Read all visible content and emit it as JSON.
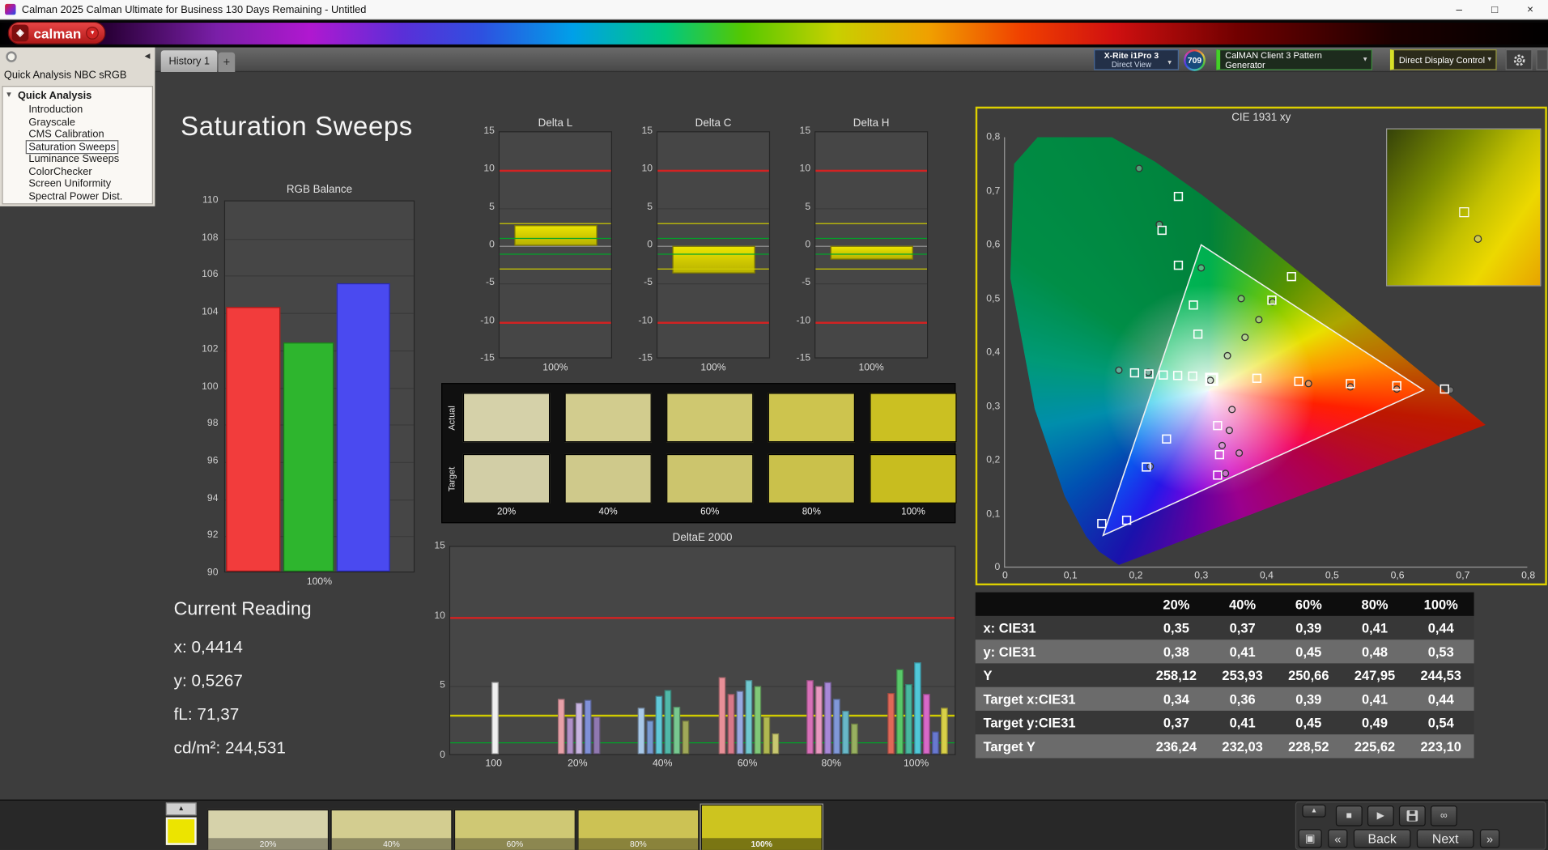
{
  "titlebar": {
    "title": "Calman 2025 Calman Ultimate for Business 130 Days Remaining  - Untitled",
    "minimize": "–",
    "maximize": "□",
    "close": "×"
  },
  "header": {
    "logo_text": "calman",
    "logo_diamond": "◈",
    "logo_caret": "▼"
  },
  "toolbar": {
    "tab": "History 1",
    "add_tab": "+",
    "meter": {
      "line1": "X-Rite i1Pro 3",
      "line2": "Direct View"
    },
    "badge": "709",
    "pattern_generator": "CalMAN Client 3 Pattern Generator",
    "display_control": "Direct Display Control",
    "caret": "▼"
  },
  "sidebar": {
    "icons": {
      "collapse": "◂",
      "toggle": "▾"
    },
    "title": "Quick Analysis NBC sRGB",
    "root": "Quick Analysis",
    "items": [
      "Introduction",
      "Grayscale",
      "CMS Calibration",
      "Saturation Sweeps",
      "Luminance Sweeps",
      "ColorChecker",
      "Screen Uniformity",
      "Spectral Power Dist."
    ],
    "selected": "Saturation Sweeps"
  },
  "main": {
    "title": "Saturation Sweeps",
    "saturation_swatches": {
      "row_labels": [
        "Actual",
        "Target"
      ],
      "percent_labels": [
        "20%",
        "40%",
        "60%",
        "80%",
        "100%"
      ],
      "actual": [
        "#d5d1a9",
        "#d2cc8e",
        "#cfc870",
        "#cdc44e",
        "#cbc022"
      ],
      "target": [
        "#d2cea6",
        "#cfc98b",
        "#ccc56d",
        "#cac14b",
        "#c8bd1f"
      ]
    },
    "current_reading": {
      "heading": "Current Reading",
      "lines": [
        "x: 0,4414",
        "y: 0,5267",
        "fL: 71,37",
        "cd/m²: 244,531"
      ]
    }
  },
  "chart_data": {
    "rgb_balance": {
      "type": "bar",
      "title": "RGB Balance",
      "xlabel": "100%",
      "categories": [
        "Red",
        "Green",
        "Blue"
      ],
      "values": [
        104.2,
        102.3,
        105.5
      ],
      "colors": [
        "#f23c3c",
        "#2eb52e",
        "#4a4af0"
      ],
      "border_colors": [
        "#a01818",
        "#1a7a1a",
        "#2828b0"
      ],
      "ylim": [
        90,
        110
      ],
      "ytick": 2
    },
    "delta_charts": {
      "type": "bar",
      "ylim": [
        -15,
        15
      ],
      "ytick": 5,
      "ref_lines": {
        "red": [
          10,
          -10
        ],
        "yellow": [
          3,
          -3
        ],
        "green": [
          1,
          -1
        ]
      },
      "charts": [
        {
          "title": "Delta L",
          "value": 2.8,
          "xlabel": "100%"
        },
        {
          "title": "Delta C",
          "value": -3.6,
          "xlabel": "100%"
        },
        {
          "title": "Delta H",
          "value": -1.8,
          "xlabel": "100%"
        }
      ]
    },
    "deltae2000": {
      "type": "bar",
      "title": "DeltaE 2000",
      "ylim": [
        0,
        15
      ],
      "yticks": [
        0,
        5,
        10,
        15
      ],
      "ref_lines": {
        "red": 10,
        "yellow": 3,
        "green": 1
      },
      "groups": [
        {
          "label": "100",
          "center": 45,
          "bars": [
            [
              5.2,
              "#f0f0f0"
            ]
          ]
        },
        {
          "label": "20%",
          "center": 130,
          "bars": [
            [
              4.0,
              "#e8a0a8"
            ],
            [
              2.6,
              "#b090c8"
            ],
            [
              3.7,
              "#c8b4e0"
            ],
            [
              3.9,
              "#8090d8"
            ],
            [
              2.7,
              "#9078b0"
            ]
          ]
        },
        {
          "label": "40%",
          "center": 216,
          "bars": [
            [
              3.3,
              "#a8c8e8"
            ],
            [
              2.4,
              "#7898d0"
            ],
            [
              4.2,
              "#60c8d8"
            ],
            [
              4.6,
              "#50b8a8"
            ],
            [
              3.4,
              "#78c890"
            ],
            [
              2.4,
              "#a0a858"
            ]
          ]
        },
        {
          "label": "60%",
          "center": 302,
          "bars": [
            [
              5.5,
              "#e89098"
            ],
            [
              4.3,
              "#d87888"
            ],
            [
              4.5,
              "#98a8e0"
            ],
            [
              5.3,
              "#70c8d0"
            ],
            [
              4.9,
              "#80c878"
            ],
            [
              2.7,
              "#b0b850"
            ],
            [
              1.5,
              "#c8c870"
            ]
          ]
        },
        {
          "label": "80%",
          "center": 387,
          "bars": [
            [
              5.3,
              "#d870b8"
            ],
            [
              4.9,
              "#e898c0"
            ],
            [
              5.2,
              "#a888d8"
            ],
            [
              4.0,
              "#8098d8"
            ],
            [
              3.1,
              "#68b8c8"
            ],
            [
              2.2,
              "#98b060"
            ]
          ]
        },
        {
          "label": "100%",
          "center": 473,
          "bars": [
            [
              4.4,
              "#e06858"
            ],
            [
              6.1,
              "#58c868"
            ],
            [
              5.0,
              "#48b8a0"
            ],
            [
              6.6,
              "#50c8d8"
            ],
            [
              4.3,
              "#d868c8"
            ],
            [
              1.6,
              "#6878d0"
            ],
            [
              3.3,
              "#d8d048"
            ]
          ]
        }
      ]
    },
    "cie1931": {
      "type": "scatter",
      "title": "CIE 1931 xy",
      "xlim": [
        0,
        0.8
      ],
      "ylim": [
        0,
        0.8
      ],
      "xticks": [
        "0",
        "0,1",
        "0,2",
        "0,3",
        "0,4",
        "0,5",
        "0,6",
        "0,7",
        "0,8"
      ],
      "yticks": [
        "0",
        "0,1",
        "0,2",
        "0,3",
        "0,4",
        "0,5",
        "0,6",
        "0,7",
        "0,8"
      ],
      "locus": [
        [
          0.1741,
          0.005
        ],
        [
          0.144,
          0.0297
        ],
        [
          0.1241,
          0.0578
        ],
        [
          0.0913,
          0.1327
        ],
        [
          0.0454,
          0.295
        ],
        [
          0.0082,
          0.5384
        ],
        [
          0.0139,
          0.7502
        ],
        [
          0.0743,
          0.8338
        ],
        [
          0.1547,
          0.8059
        ],
        [
          0.2296,
          0.7543
        ],
        [
          0.3016,
          0.6923
        ],
        [
          0.3731,
          0.6245
        ],
        [
          0.4441,
          0.5547
        ],
        [
          0.5125,
          0.4866
        ],
        [
          0.5752,
          0.4242
        ],
        [
          0.627,
          0.3725
        ],
        [
          0.6915,
          0.3083
        ],
        [
          0.7347,
          0.2653
        ]
      ],
      "srgb_triangle": [
        [
          0.64,
          0.33
        ],
        [
          0.3,
          0.6
        ],
        [
          0.15,
          0.06
        ]
      ],
      "white_point": [
        0.313,
        0.329
      ],
      "current_square": [
        0.316,
        0.35
      ],
      "target_squares": [
        [
          0.265,
          0.69
        ],
        [
          0.24,
          0.627
        ],
        [
          0.265,
          0.562
        ],
        [
          0.288,
          0.488
        ],
        [
          0.295,
          0.434
        ],
        [
          0.408,
          0.497
        ],
        [
          0.438,
          0.541
        ],
        [
          0.198,
          0.362
        ],
        [
          0.22,
          0.36
        ],
        [
          0.242,
          0.358
        ],
        [
          0.264,
          0.357
        ],
        [
          0.287,
          0.356
        ],
        [
          0.385,
          0.352
        ],
        [
          0.449,
          0.346
        ],
        [
          0.528,
          0.342
        ],
        [
          0.599,
          0.338
        ],
        [
          0.672,
          0.332
        ],
        [
          0.247,
          0.239
        ],
        [
          0.216,
          0.187
        ],
        [
          0.325,
          0.264
        ],
        [
          0.328,
          0.21
        ],
        [
          0.325,
          0.172
        ],
        [
          0.186,
          0.088
        ],
        [
          0.148,
          0.082
        ]
      ],
      "measured_points": [
        [
          0.205,
          0.742
        ],
        [
          0.236,
          0.638
        ],
        [
          0.3,
          0.557
        ],
        [
          0.361,
          0.5
        ],
        [
          0.409,
          0.494
        ],
        [
          0.388,
          0.461
        ],
        [
          0.367,
          0.428
        ],
        [
          0.34,
          0.394
        ],
        [
          0.314,
          0.348
        ],
        [
          0.347,
          0.294
        ],
        [
          0.343,
          0.255
        ],
        [
          0.332,
          0.227
        ],
        [
          0.358,
          0.213
        ],
        [
          0.337,
          0.175
        ],
        [
          0.174,
          0.367
        ],
        [
          0.219,
          0.363
        ],
        [
          0.464,
          0.342
        ],
        [
          0.528,
          0.336
        ],
        [
          0.599,
          0.332
        ],
        [
          0.681,
          0.33
        ],
        [
          0.222,
          0.188
        ]
      ],
      "inset_markers": {
        "square": [
          0.47,
          0.5
        ],
        "circle": [
          0.57,
          0.68
        ]
      }
    }
  },
  "table": {
    "columns": [
      "",
      "20%",
      "40%",
      "60%",
      "80%",
      "100%"
    ],
    "rows": [
      {
        "label": "x: CIE31",
        "values": [
          "0,35",
          "0,37",
          "0,39",
          "0,41",
          "0,44"
        ]
      },
      {
        "label": "y: CIE31",
        "values": [
          "0,38",
          "0,41",
          "0,45",
          "0,48",
          "0,53"
        ]
      },
      {
        "label": "Y",
        "values": [
          "258,12",
          "253,93",
          "250,66",
          "247,95",
          "244,53"
        ]
      },
      {
        "label": "Target x:CIE31",
        "values": [
          "0,34",
          "0,36",
          "0,39",
          "0,41",
          "0,44"
        ]
      },
      {
        "label": "Target y:CIE31",
        "values": [
          "0,37",
          "0,41",
          "0,45",
          "0,49",
          "0,54"
        ]
      },
      {
        "label": "Target Y",
        "values": [
          "236,24",
          "232,03",
          "228,52",
          "225,62",
          "223,10"
        ]
      }
    ]
  },
  "bottombar": {
    "pattern_color": "#ece400",
    "swatches": [
      {
        "label": "20%",
        "color": "#d6d2aa"
      },
      {
        "label": "40%",
        "color": "#d3cd90"
      },
      {
        "label": "60%",
        "color": "#cfc874"
      },
      {
        "label": "80%",
        "color": "#ccc254"
      },
      {
        "label": "100%",
        "color": "#cdc41f",
        "active": true
      }
    ],
    "icons": {
      "eject": "▲",
      "expand": "▲",
      "stop": "■",
      "play": "▶",
      "loop": "∞",
      "window": "▣",
      "prev": "«",
      "next": "»"
    },
    "back": "Back",
    "next": "Next"
  }
}
